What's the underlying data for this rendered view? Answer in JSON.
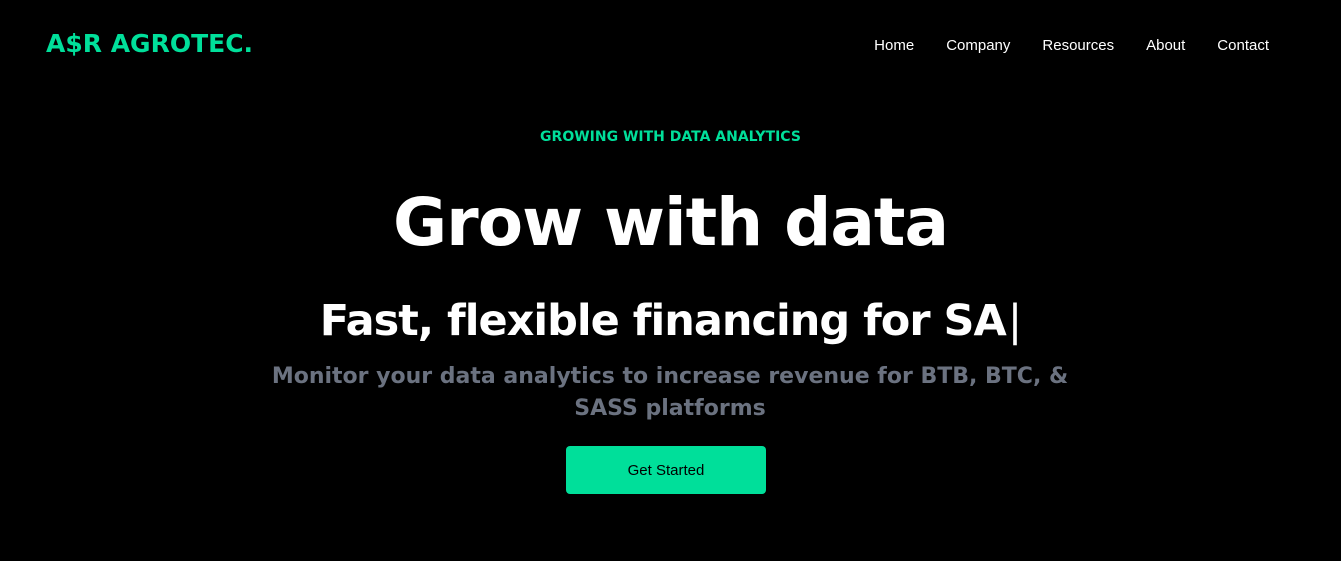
{
  "brand": {
    "logo_text": "A$R AGROTEC.",
    "accent_color": "#00df9a"
  },
  "nav": {
    "items": [
      {
        "label": "Home"
      },
      {
        "label": "Company"
      },
      {
        "label": "Resources"
      },
      {
        "label": "About"
      },
      {
        "label": "Contact"
      }
    ]
  },
  "hero": {
    "eyebrow": "GROWING WITH DATA ANALYTICS",
    "headline": "Grow with data",
    "subheadline": "Fast, flexible financing for SA",
    "cursor": "|",
    "description": "Monitor your data analytics to increase revenue for BTB, BTC, & SASS platforms",
    "cta_label": "Get Started"
  },
  "colors": {
    "background": "#000000",
    "text": "#ffffff",
    "muted_text": "#6b7280",
    "button_text": "#000000"
  }
}
